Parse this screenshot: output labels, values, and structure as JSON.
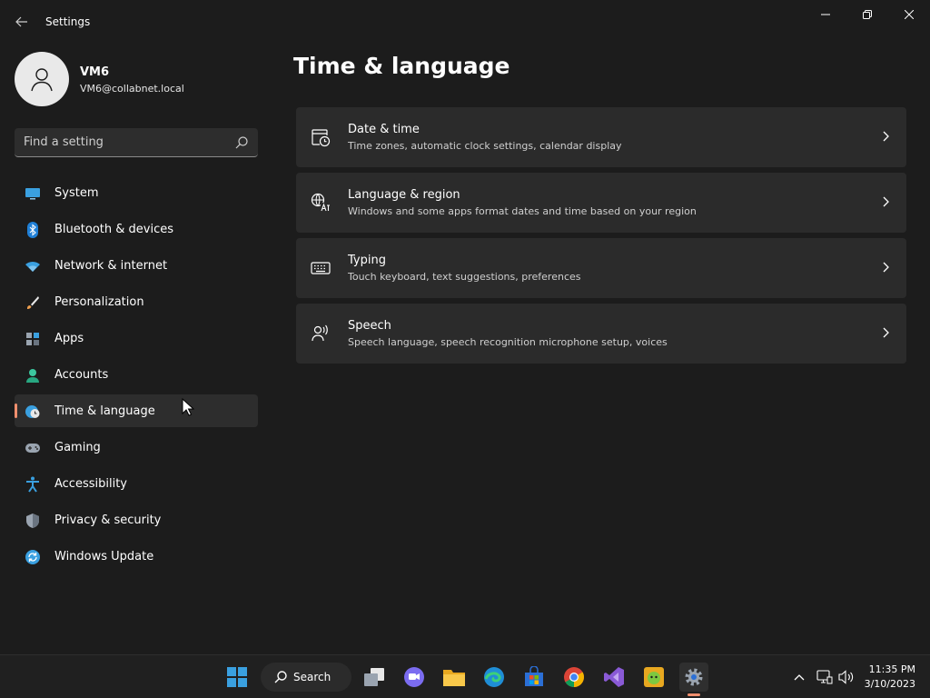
{
  "window": {
    "title": "Settings"
  },
  "profile": {
    "name": "VM6",
    "email": "VM6@collabnet.local"
  },
  "search": {
    "placeholder": "Find a setting"
  },
  "nav": {
    "items": [
      {
        "label": "System",
        "icon": "monitor-icon"
      },
      {
        "label": "Bluetooth & devices",
        "icon": "bluetooth-icon"
      },
      {
        "label": "Network & internet",
        "icon": "wifi-icon"
      },
      {
        "label": "Personalization",
        "icon": "brush-icon"
      },
      {
        "label": "Apps",
        "icon": "apps-icon"
      },
      {
        "label": "Accounts",
        "icon": "person-icon"
      },
      {
        "label": "Time & language",
        "icon": "globe-clock-icon",
        "active": true
      },
      {
        "label": "Gaming",
        "icon": "gamepad-icon"
      },
      {
        "label": "Accessibility",
        "icon": "accessibility-icon"
      },
      {
        "label": "Privacy & security",
        "icon": "shield-icon"
      },
      {
        "label": "Windows Update",
        "icon": "update-icon"
      }
    ]
  },
  "main": {
    "title": "Time & language",
    "cards": [
      {
        "title": "Date & time",
        "desc": "Time zones, automatic clock settings, calendar display",
        "icon": "calendar-clock-icon"
      },
      {
        "title": "Language & region",
        "desc": "Windows and some apps format dates and time based on your region",
        "icon": "language-icon"
      },
      {
        "title": "Typing",
        "desc": "Touch keyboard, text suggestions, preferences",
        "icon": "keyboard-icon"
      },
      {
        "title": "Speech",
        "desc": "Speech language, speech recognition microphone setup, voices",
        "icon": "speech-icon"
      }
    ]
  },
  "taskbar": {
    "search_label": "Search",
    "clock": {
      "time": "11:35 PM",
      "date": "3/10/2023"
    }
  },
  "colors": {
    "accent": "#f08f6e",
    "background": "#1c1c1c",
    "card": "#2b2b2b"
  }
}
